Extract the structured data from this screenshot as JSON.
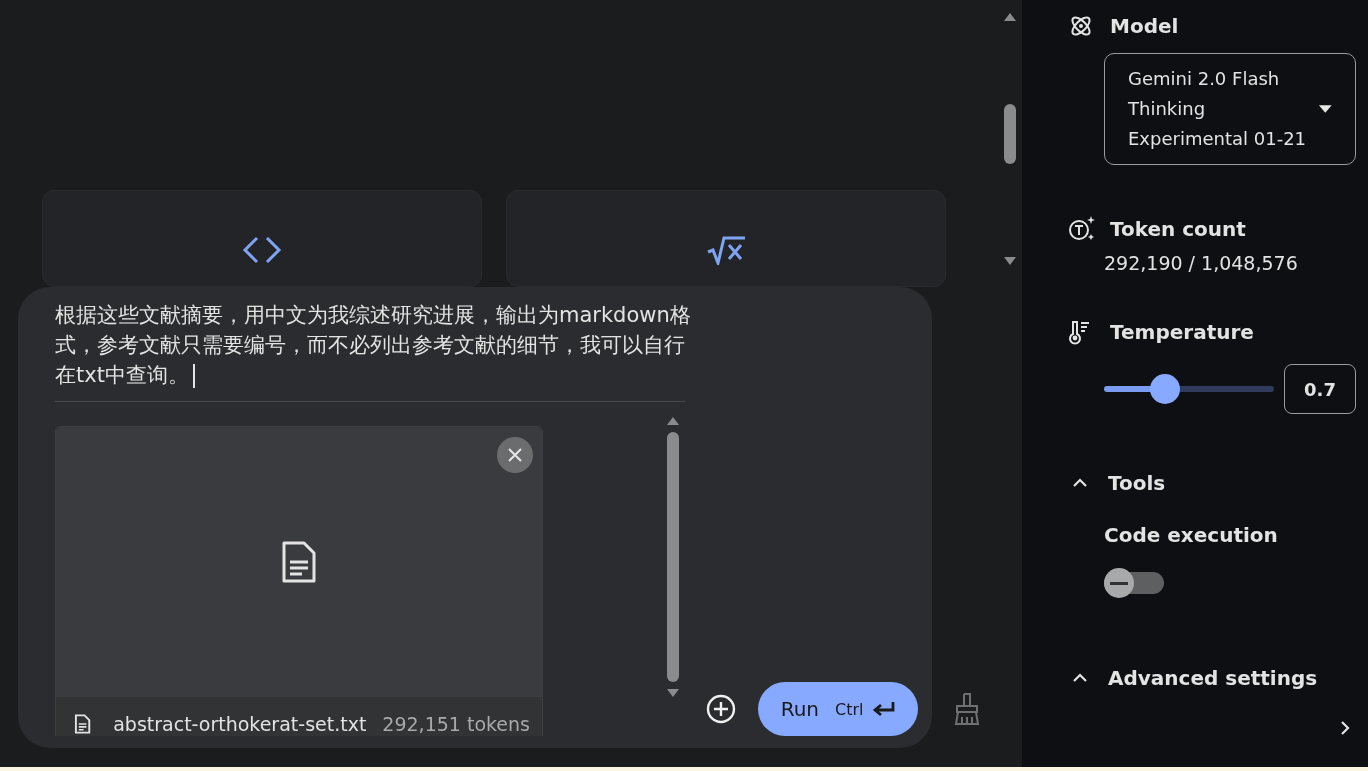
{
  "main": {
    "cards": [
      {
        "kind": "code"
      },
      {
        "kind": "math"
      }
    ]
  },
  "prompt": {
    "value": "根据这些文献摘要，用中文为我综述研究进展，输出为markdown格式，参考文献只需要编号，而不必列出参考文献的细节，我可以自行在txt中查询。",
    "attachment": {
      "filename": "abstract-orthokerat-set.txt",
      "tokens": "292,151 tokens"
    },
    "run_button": {
      "label": "Run",
      "shortcut": "Ctrl"
    }
  },
  "settings": {
    "model": {
      "label": "Model",
      "value": "Gemini 2.0 Flash Thinking Experimental 01-21"
    },
    "token_count": {
      "label": "Token count",
      "value": "292,190 / 1,048,576"
    },
    "temperature": {
      "label": "Temperature",
      "level": 0.35,
      "value": "0.7"
    },
    "tools": {
      "label": "Tools",
      "expanded": true,
      "items": [
        {
          "label": "Code execution",
          "on": false
        }
      ]
    },
    "advanced": {
      "label": "Advanced settings",
      "expanded": true
    }
  }
}
